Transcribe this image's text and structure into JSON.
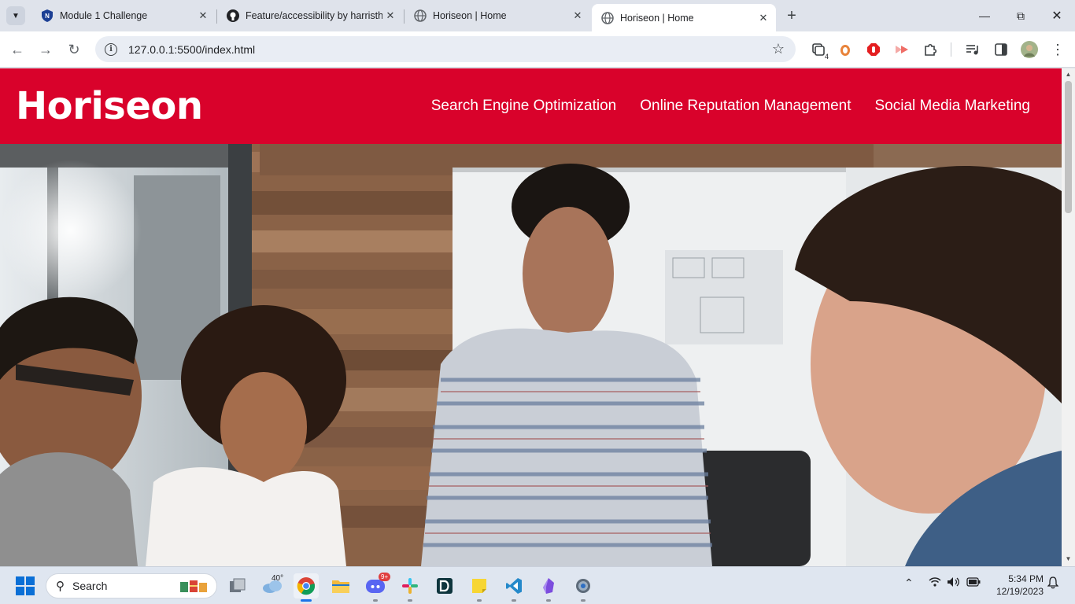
{
  "browser": {
    "tabs": [
      {
        "title": "Module 1 Challenge"
      },
      {
        "title": "Feature/accessibility by harristh"
      },
      {
        "title": "Horiseon | Home"
      },
      {
        "title": "Horiseon | Home"
      }
    ],
    "url": "127.0.0.1:5500/index.html",
    "extension_badge": "4"
  },
  "site": {
    "logo_part1": "Hori",
    "logo_part2": "seon",
    "nav": [
      {
        "label": "Search Engine Optimization"
      },
      {
        "label": "Online Reputation Management"
      },
      {
        "label": "Social Media Marketing"
      }
    ],
    "colors": {
      "header_bg": "#d9022b",
      "text": "#ffffff"
    }
  },
  "taskbar": {
    "search_label": "Search",
    "weather_temp": "40°",
    "discord_badge": "9+",
    "time": "5:34 PM",
    "date": "12/19/2023"
  }
}
